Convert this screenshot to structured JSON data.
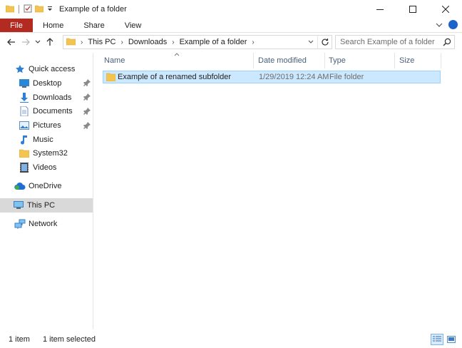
{
  "window": {
    "title": "Example of a folder",
    "minimize": "—",
    "maximize": "☐",
    "close": "✕"
  },
  "ribbon": {
    "tabs": [
      {
        "label": "File"
      },
      {
        "label": "Home"
      },
      {
        "label": "Share"
      },
      {
        "label": "View"
      }
    ],
    "help": "?"
  },
  "address": {
    "crumbs": [
      "This PC",
      "Downloads",
      "Example of a folder"
    ]
  },
  "search": {
    "placeholder": "Search Example of a folder"
  },
  "navpane": {
    "quick_access": "Quick access",
    "quick_items": [
      {
        "label": "Desktop",
        "pinned": true
      },
      {
        "label": "Downloads",
        "pinned": true
      },
      {
        "label": "Documents",
        "pinned": true
      },
      {
        "label": "Pictures",
        "pinned": true
      },
      {
        "label": "Music",
        "pinned": false
      },
      {
        "label": "System32",
        "pinned": false
      },
      {
        "label": "Videos",
        "pinned": false
      }
    ],
    "onedrive": "OneDrive",
    "this_pc": "This PC",
    "network": "Network"
  },
  "columns": {
    "name": "Name",
    "date": "Date modified",
    "type": "Type",
    "size": "Size"
  },
  "files": [
    {
      "name": "Example of a renamed subfolder",
      "date": "1/29/2019 12:24 AM",
      "type": "File folder",
      "size": ""
    }
  ],
  "status": {
    "count": "1 item",
    "selected": "1 item selected"
  },
  "colors": {
    "file_tab": "#b22a20",
    "selection_fill": "#cce8ff",
    "selection_border": "#99d1ff",
    "folder": "#f3c44f",
    "header_text": "#4c607a"
  }
}
